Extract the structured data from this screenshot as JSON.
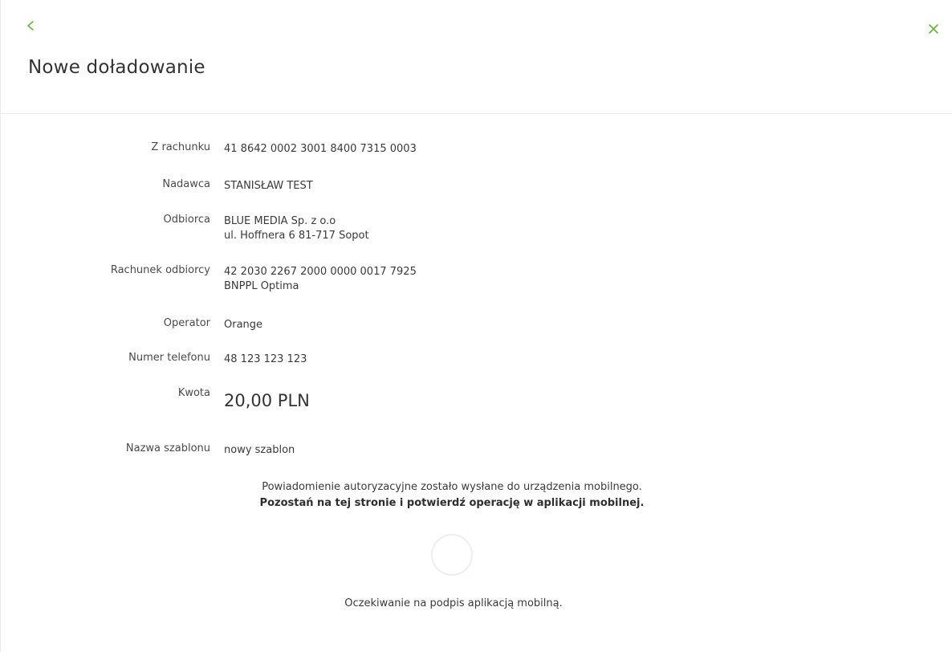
{
  "header": {
    "title": "Nowe doładowanie",
    "accent_color": "#5fb936"
  },
  "details": {
    "account_label": "Z rachunku",
    "account_value": "41 8642 0002 3001 8400 7315 0003",
    "sender_label": "Nadawca",
    "sender_value": "STANISŁAW TEST",
    "recipient_label": "Odbiorca",
    "recipient_line1": "BLUE MEDIA Sp. z o.o",
    "recipient_line2": "ul. Hoffnera 6 81-717 Sopot",
    "recipient_account_label": "Rachunek odbiorcy",
    "recipient_account_line1": "42 2030 2267 2000 0000 0017 7925",
    "recipient_account_line2": "BNPPL Optima",
    "operator_label": "Operator",
    "operator_value": "Orange",
    "phone_label": "Numer telefonu",
    "phone_value": "48 123 123 123",
    "amount_label": "Kwota",
    "amount_value": "20,00 PLN",
    "template_label": "Nazwa szablonu",
    "template_value": "nowy szablon"
  },
  "notice": {
    "line1": "Powiadomienie autoryzacyjne zostało wysłane do urządzenia mobilnego.",
    "line2": "Pozostań na tej stronie i potwierdź operację w aplikacji mobilnej."
  },
  "status": {
    "waiting_text": "Oczekiwanie na podpis aplikacją mobilną."
  },
  "icons": {
    "back": "chevron-left-icon",
    "close": "close-icon",
    "spinner": "loading-spinner"
  }
}
